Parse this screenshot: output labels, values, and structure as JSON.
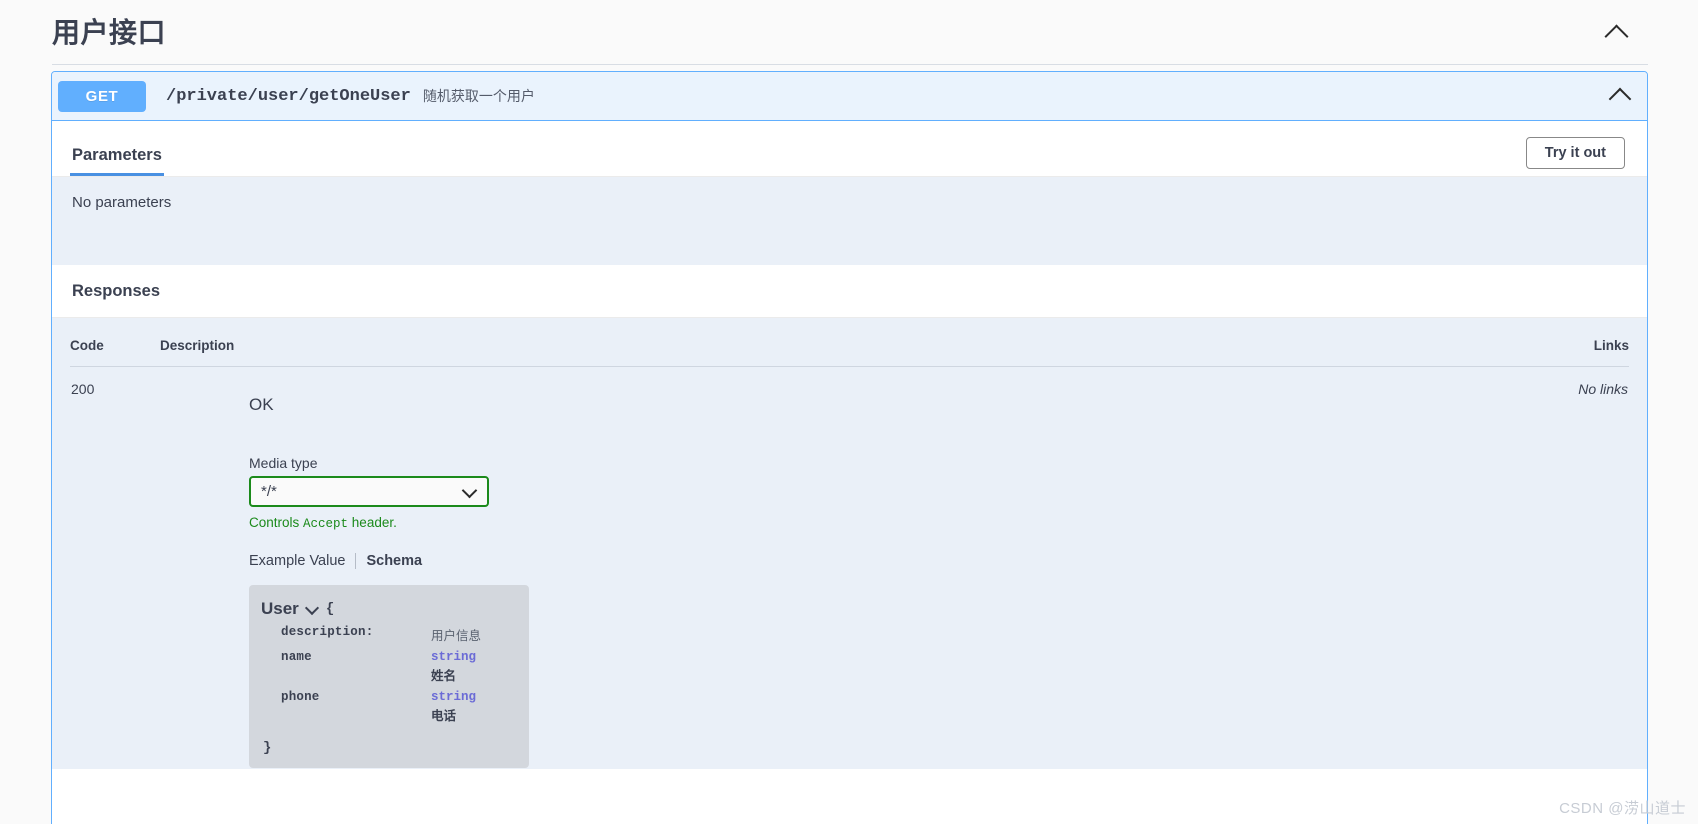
{
  "tag": {
    "title": "用户接口",
    "collapse_icon": "chevron-up-icon"
  },
  "operation": {
    "method": "GET",
    "path": "/private/user/getOneUser",
    "summary": "随机获取一个用户",
    "collapse_icon": "chevron-up-icon",
    "method_color": "#61affe",
    "border_color": "#61affe",
    "summary_bg": "#eaf3fd"
  },
  "parameters": {
    "tab_label": "Parameters",
    "try_it_out_label": "Try it out",
    "empty_text": "No parameters"
  },
  "responses": {
    "title": "Responses",
    "columns": {
      "code": "Code",
      "description": "Description",
      "links": "Links"
    },
    "rows": [
      {
        "code": "200",
        "status_text": "OK",
        "links": "No links",
        "media_type_label": "Media type",
        "media_type_value": "*/*",
        "media_select_border": "#1b8a1b",
        "controls_note_prefix": "Controls ",
        "controls_note_code": "Accept",
        "controls_note_suffix": " header.",
        "example_tab": "Example Value",
        "schema_tab": "Schema",
        "model": {
          "name": "User",
          "open_brace": "{",
          "close_brace": "}",
          "properties": [
            {
              "key": "description:",
              "type": "",
              "desc": "用户信息",
              "desc_style": "plain"
            },
            {
              "key": "name",
              "type": "string",
              "desc": "姓名",
              "desc_style": "bold"
            },
            {
              "key": "phone",
              "type": "string",
              "desc": "电话",
              "desc_style": "bold"
            }
          ]
        }
      }
    ]
  },
  "watermark": {
    "text": "CSDN @涝山道士"
  }
}
